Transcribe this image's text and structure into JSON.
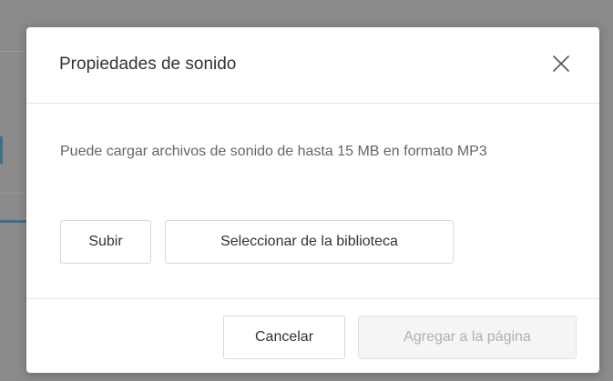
{
  "dialog": {
    "title": "Propiedades de sonido",
    "close_icon": "close-icon",
    "description": "Puede cargar archivos de sonido de hasta 15 MB en formato MP3",
    "upload_label": "Subir",
    "library_label": "Seleccionar de la biblioteca",
    "cancel_label": "Cancelar",
    "add_label": "Agregar a la página",
    "add_enabled": false
  },
  "colors": {
    "overlay": "#8a8a8a",
    "dialog_bg": "#ffffff",
    "text": "#333333",
    "muted_text": "#666666",
    "disabled_text": "#b0b0b0"
  }
}
